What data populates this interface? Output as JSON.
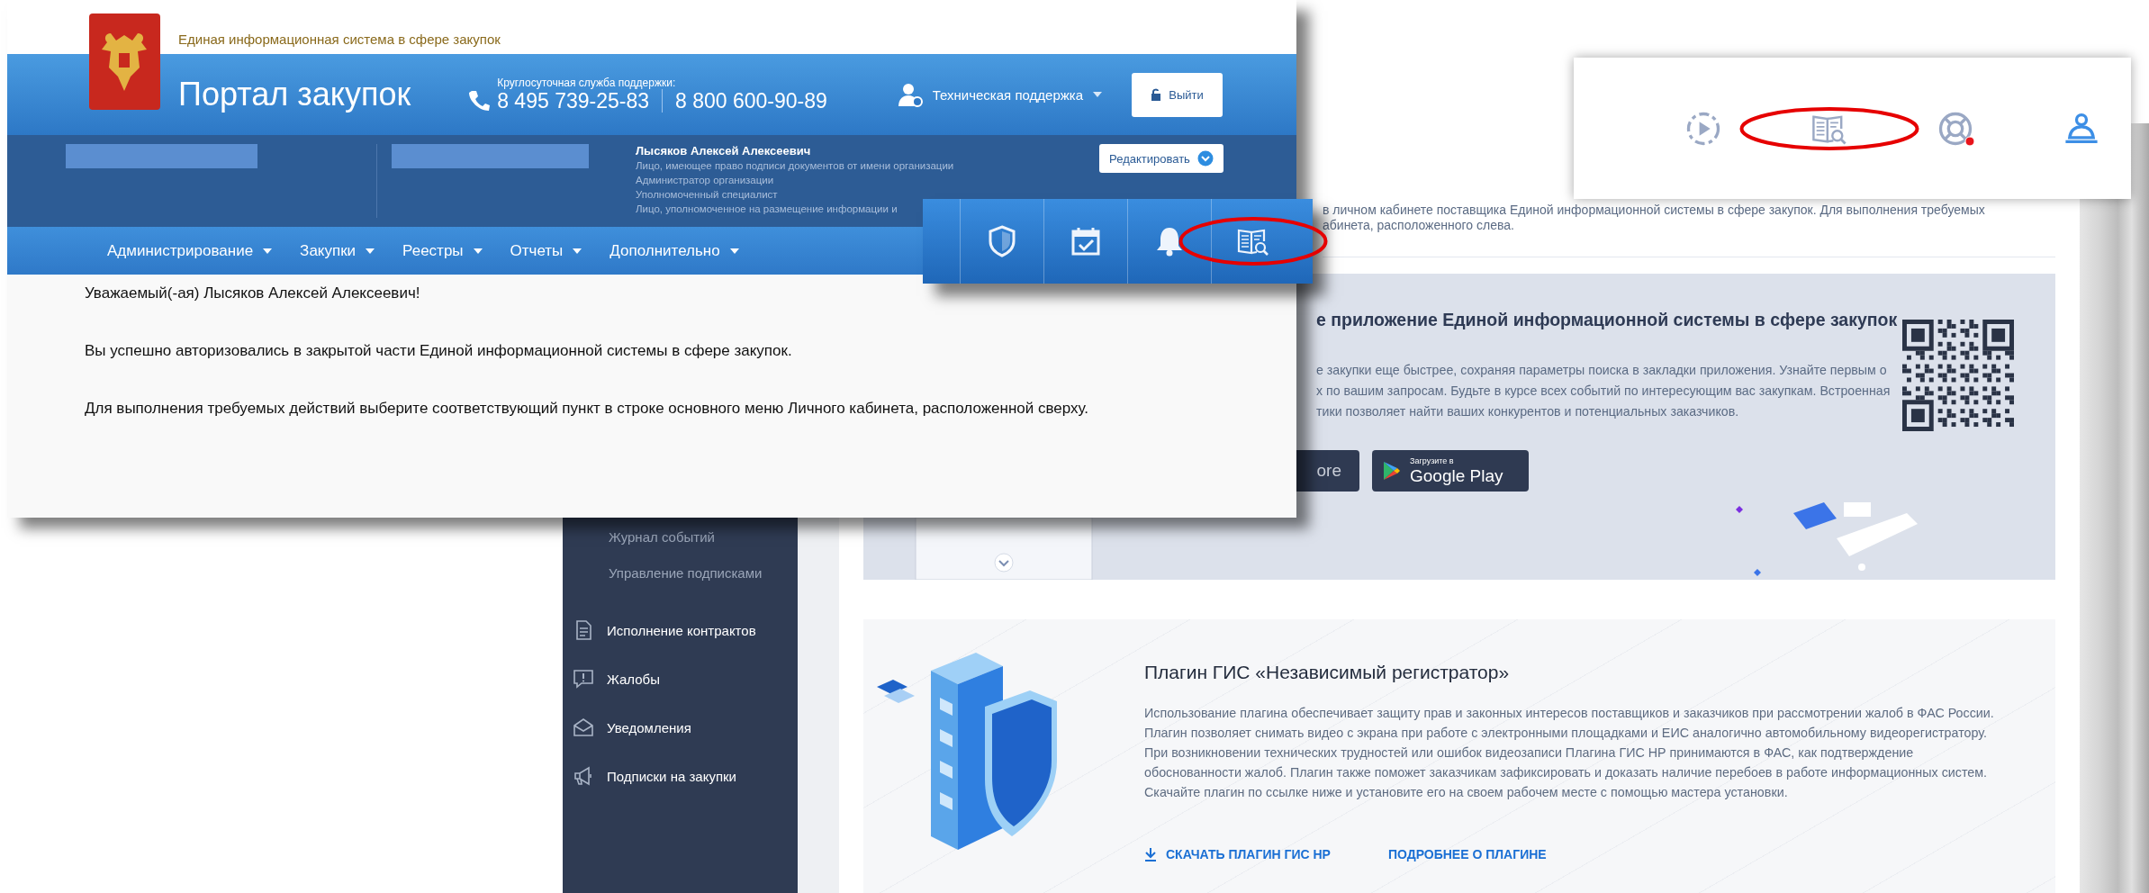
{
  "old_portal": {
    "system_name": "Единая информационная система в сфере закупок",
    "portal_title": "Портал закупок",
    "support_label": "Круглосуточная служба поддержки:",
    "phone_1": "8 495 739-25-83",
    "phone_2": "8 800 600-90-89",
    "support_menu": "Техническая поддержка",
    "logout_button": "Выйти",
    "user": {
      "name": "Лысяков Алексей Алексеевич",
      "roles": [
        "Лицо, имеющее право подписи документов от имени организации",
        "Администратор организации",
        "Уполномоченный специалист",
        "Лицо, уполномоченное на размещение информации и"
      ]
    },
    "edit_button": "Редактировать",
    "nav": [
      {
        "label": "Администрирование"
      },
      {
        "label": "Закупки"
      },
      {
        "label": "Реестры"
      },
      {
        "label": "Отчеты"
      },
      {
        "label": "Дополнительно"
      }
    ],
    "messages": [
      "Уважаемый(-ая) Лысяков Алексей Алексеевич!",
      "Вы успешно авторизовались в закрытой части Единой информационной системы в сфере закупок.",
      "Для выполнения требуемых действий выберите соответствующий пункт в строке основного меню Личного кабинета, расположенной сверху."
    ]
  },
  "toolbar_popup": {
    "icons": [
      {
        "kind": "shield",
        "highlighted": false
      },
      {
        "kind": "calendar",
        "highlighted": false
      },
      {
        "kind": "bell",
        "highlighted": false
      },
      {
        "kind": "book-search",
        "highlighted": true
      }
    ]
  },
  "header_icons": {
    "icons": [
      {
        "kind": "play",
        "highlighted": false,
        "notification": false
      },
      {
        "kind": "book-search",
        "highlighted": true,
        "notification": false
      },
      {
        "kind": "lifebuoy",
        "highlighted": false,
        "notification": true
      },
      {
        "kind": "user",
        "highlighted": false,
        "notification": false
      }
    ]
  },
  "new_portal": {
    "intro_lines": [
      "в личном кабинете поставщика Единой информационной системы в сфере закупок. Для выполнения требуемых",
      "абинета, расположенного слева."
    ],
    "sidebar": {
      "items": [
        {
          "kind": "sub",
          "label": "Журнал событий"
        },
        {
          "kind": "sub",
          "label": "Управление подписками"
        },
        {
          "kind": "doc",
          "label": "Исполнение контрактов"
        },
        {
          "kind": "complaint",
          "label": "Жалобы"
        },
        {
          "kind": "mail",
          "label": "Уведомления"
        },
        {
          "kind": "megaphone",
          "label": "Подписки на закупки"
        }
      ]
    },
    "app_card": {
      "title": "е приложение Единой информационной системы в сфере закупок",
      "lines": [
        "е закупки еще быстрее, сохраняя параметры поиска в закладки приложения. Узнайте первым о",
        "х по вашим запросам. Будьте в курсе всех событий по интересующим вас закупкам. Встроенная",
        "тики позволяет найти ваших конкурентов и потенциальных заказчиков."
      ],
      "store_buttons": [
        {
          "kind": "apple",
          "label": "ore"
        },
        {
          "kind": "google",
          "caption": "Загрузите в",
          "label": "Google Play"
        }
      ]
    },
    "plugin_card": {
      "title": "Плагин ГИС «Независимый регистратор»",
      "text": "Использование плагина обеспечивает защиту прав и законных интересов поставщиков и заказчиков при рассмотрении жалоб в ФАС России. Плагин позволяет снимать видео с экрана при работе с электронными площадками и ЕИС аналогично автомобильному видеорегистратору. При возникновении технических трудностей или ошибок видеозаписи Плагина ГИС НР принимаются в ФАС, как подтверждение обоснованности жалоб. Плагин также поможет заказчикам зафиксировать и доказать наличие перебоев в работе информационных систем. Скачайте плагин по ссылке ниже и установите его на своем рабочем месте с помощью мастера установки.",
      "links": [
        {
          "kind": "download",
          "label": "СКАЧАТЬ ПЛАГИН ГИС НР"
        },
        {
          "kind": "plain",
          "label": "ПОДРОБНЕЕ О ПЛАГИНЕ"
        }
      ]
    }
  }
}
